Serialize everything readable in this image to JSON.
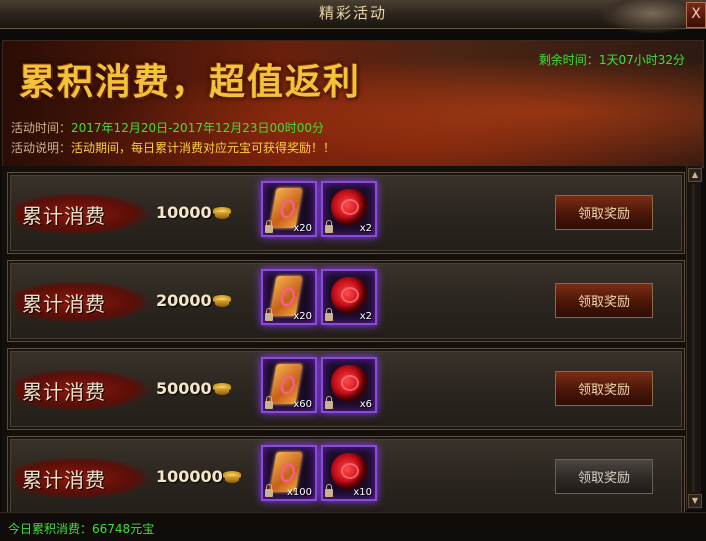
{
  "window": {
    "title": "精彩活动",
    "close_label": "X"
  },
  "banner": {
    "heading": "累积消费，超值返利",
    "countdown_label": "剩余时间：",
    "countdown_value": "1天07小时32分",
    "time_label": "活动时间：",
    "time_value": "2017年12月20日-2017年12月23日00时00分",
    "desc_label": "活动说明：",
    "desc_value": "活动期间，每日累计消费对应元宝可获得奖励！！"
  },
  "tiers": [
    {
      "label": "累计消费",
      "threshold": "10000",
      "rewards": [
        {
          "item": "scroll-item",
          "qty": "x20"
        },
        {
          "item": "rose-item",
          "qty": "x2"
        }
      ],
      "button_label": "领取奖励",
      "button_state": "active"
    },
    {
      "label": "累计消费",
      "threshold": "20000",
      "rewards": [
        {
          "item": "scroll-item",
          "qty": "x20"
        },
        {
          "item": "rose-item",
          "qty": "x2"
        }
      ],
      "button_label": "领取奖励",
      "button_state": "active"
    },
    {
      "label": "累计消费",
      "threshold": "50000",
      "rewards": [
        {
          "item": "scroll-item",
          "qty": "x60"
        },
        {
          "item": "rose-item",
          "qty": "x6"
        }
      ],
      "button_label": "领取奖励",
      "button_state": "active"
    },
    {
      "label": "累计消费",
      "threshold": "100000",
      "rewards": [
        {
          "item": "scroll-item",
          "qty": "x100"
        },
        {
          "item": "rose-item",
          "qty": "x10"
        }
      ],
      "button_label": "领取奖励",
      "button_state": "disabled"
    }
  ],
  "footer": {
    "label": "今日累积消费：",
    "value": "66748元宝"
  },
  "colors": {
    "highlight_green": "#3fe03a",
    "gold": "#f2c23a",
    "slot_glow": "#8a4cd8"
  }
}
